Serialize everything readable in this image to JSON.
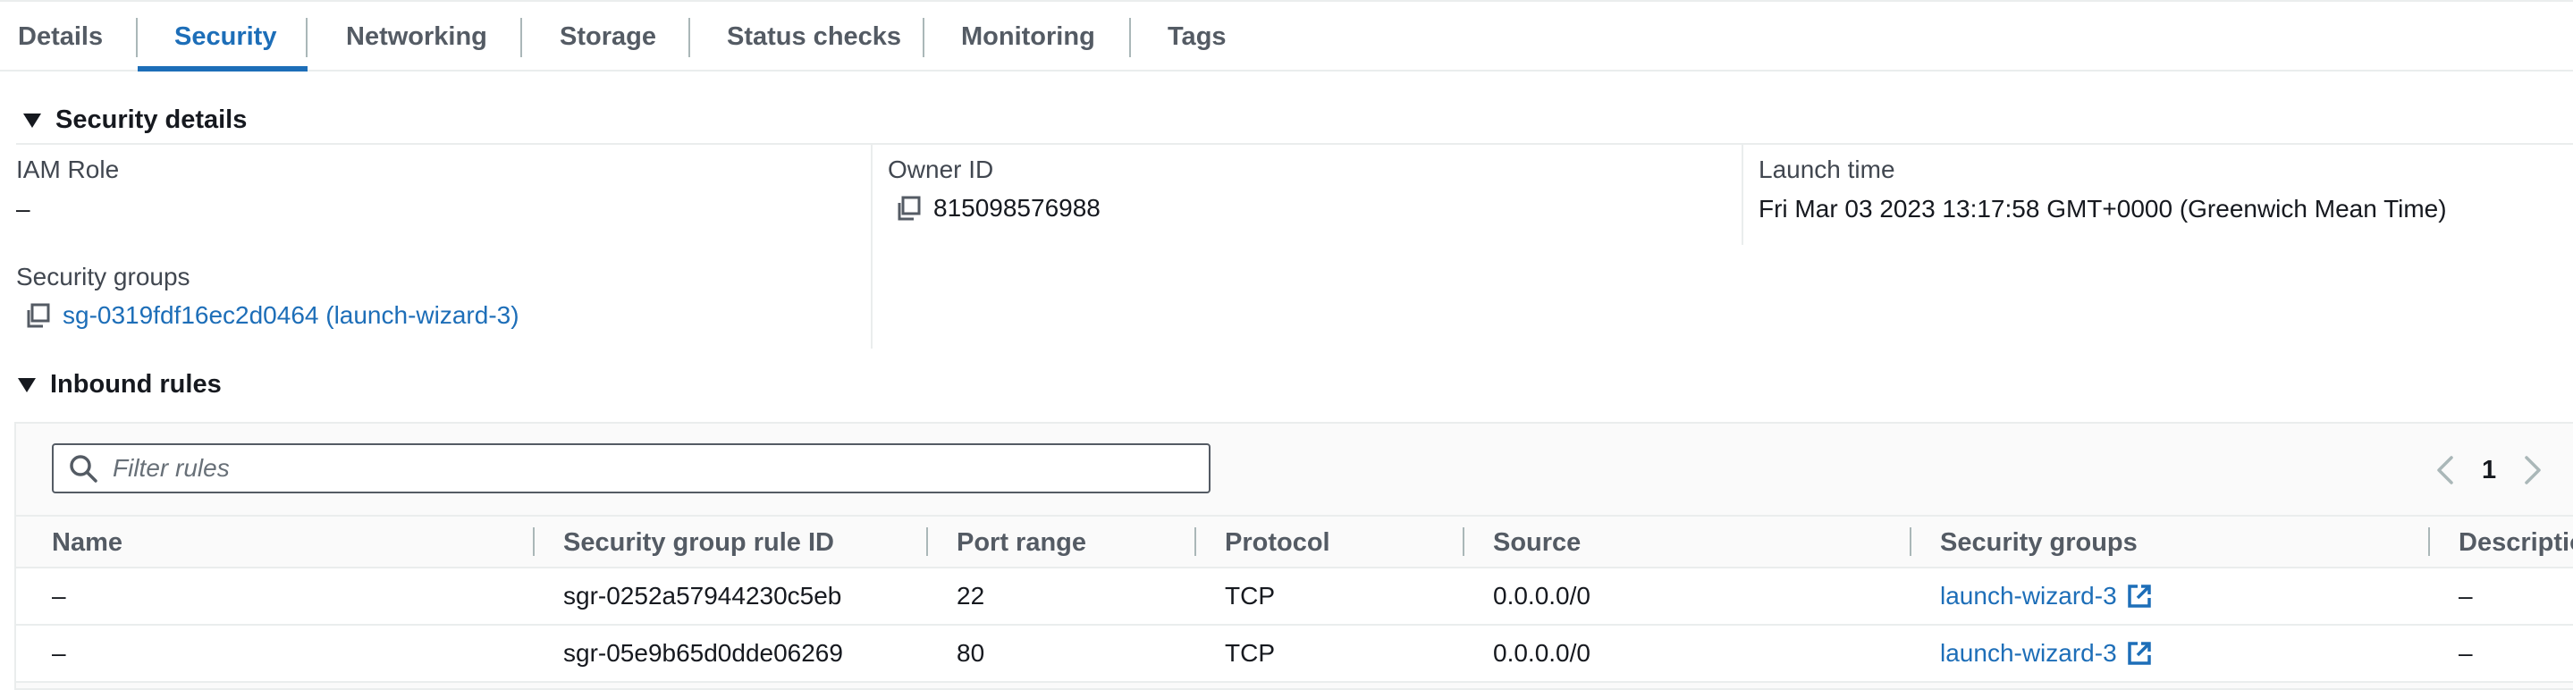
{
  "tabs": [
    {
      "label": "Details",
      "active": false
    },
    {
      "label": "Security",
      "active": true
    },
    {
      "label": "Networking",
      "active": false
    },
    {
      "label": "Storage",
      "active": false
    },
    {
      "label": "Status checks",
      "active": false
    },
    {
      "label": "Monitoring",
      "active": false
    },
    {
      "label": "Tags",
      "active": false
    }
  ],
  "security_details": {
    "heading": "Security details",
    "iam_role": {
      "label": "IAM Role",
      "value": "–"
    },
    "owner_id": {
      "label": "Owner ID",
      "value": "815098576988"
    },
    "launch_time": {
      "label": "Launch time",
      "value": "Fri Mar 03 2023 13:17:58 GMT+0000 (Greenwich Mean Time)"
    },
    "security_groups": {
      "label": "Security groups",
      "value": "sg-0319fdf16ec2d0464 (launch-wizard-3)"
    }
  },
  "inbound_rules": {
    "heading": "Inbound rules",
    "filter_placeholder": "Filter rules",
    "filter_value": "",
    "page": "1",
    "columns": [
      "Name",
      "Security group rule ID",
      "Port range",
      "Protocol",
      "Source",
      "Security groups",
      "Descriptio"
    ],
    "rows": [
      {
        "name": "–",
        "rule_id": "sgr-0252a57944230c5eb",
        "port_range": "22",
        "protocol": "TCP",
        "source": "0.0.0.0/0",
        "security_group": "launch-wizard-3",
        "description": "–"
      },
      {
        "name": "–",
        "rule_id": "sgr-05e9b65d0dde06269",
        "port_range": "80",
        "protocol": "TCP",
        "source": "0.0.0.0/0",
        "security_group": "launch-wizard-3",
        "description": "–"
      }
    ]
  },
  "colors": {
    "accent": "#1d6eb8",
    "text": "#16191f",
    "muted": "#545b64",
    "border": "#eaeded"
  },
  "icons": {
    "copy": "copy-icon",
    "search": "search-icon",
    "external_link": "external-link-icon",
    "caret": "caret-down-icon",
    "prev": "chevron-left-icon",
    "next": "chevron-right-icon"
  }
}
